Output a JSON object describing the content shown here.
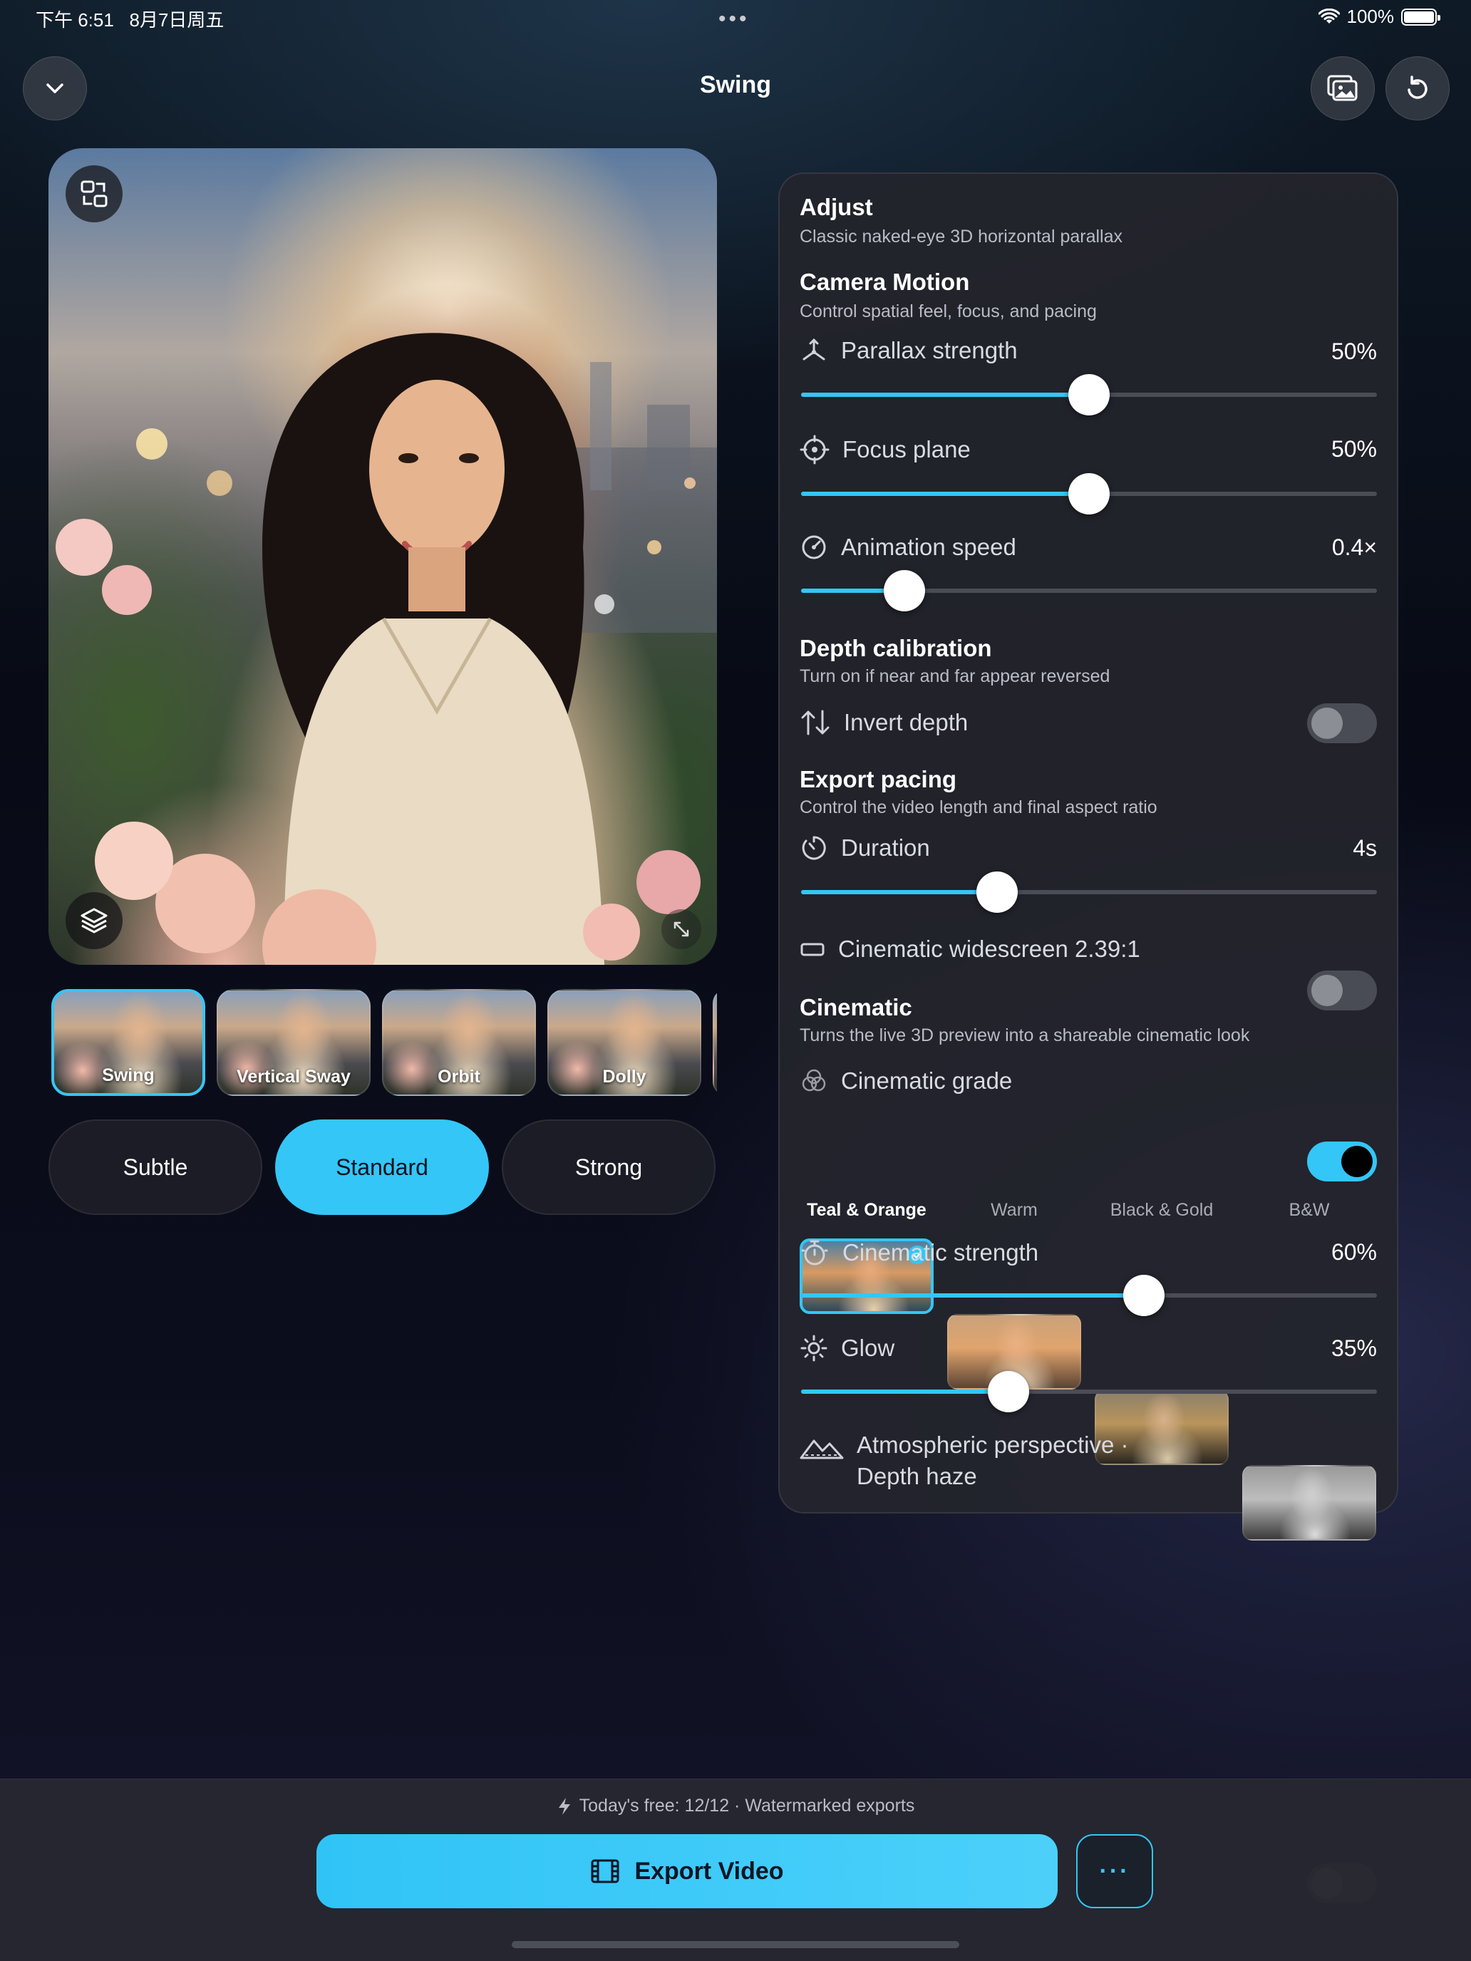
{
  "status": {
    "time": "下午 6:51   8月7日周五",
    "battery": "100%"
  },
  "header": {
    "title": "Swing"
  },
  "motions": [
    {
      "label": "Swing",
      "selected": true
    },
    {
      "label": "Vertical Sway",
      "selected": false
    },
    {
      "label": "Orbit",
      "selected": false
    },
    {
      "label": "Dolly",
      "selected": false
    }
  ],
  "intensity": {
    "options": [
      "Subtle",
      "Standard",
      "Strong"
    ],
    "selected": "Standard"
  },
  "panel": {
    "adjust": {
      "title": "Adjust",
      "subtitle": "Classic naked-eye 3D horizontal parallax"
    },
    "camera_motion": {
      "title": "Camera Motion",
      "subtitle": "Control spatial feel, focus, and pacing"
    },
    "parallax": {
      "label": "Parallax strength",
      "value": "50%",
      "level": 0.5
    },
    "focus": {
      "label": "Focus plane",
      "value": "50%",
      "level": 0.5
    },
    "speed": {
      "label": "Animation speed",
      "value": "0.4×",
      "level": 0.18
    },
    "depth": {
      "title": "Depth calibration",
      "subtitle": "Turn on if near and far appear reversed"
    },
    "invert": {
      "label": "Invert depth",
      "on": false
    },
    "export_pacing": {
      "title": "Export pacing",
      "subtitle": "Control the video length and final aspect ratio"
    },
    "duration": {
      "label": "Duration",
      "value": "4s",
      "level": 0.34
    },
    "widescreen": {
      "label": "Cinematic widescreen 2.39:1",
      "on": false
    },
    "cinematic": {
      "title": "Cinematic",
      "subtitle": "Turns the live 3D preview into a shareable cinematic look"
    },
    "grade_toggle": {
      "label": "Cinematic grade",
      "on": true
    },
    "grades": [
      {
        "label": "Teal & Orange",
        "selected": true
      },
      {
        "label": "Warm",
        "selected": false
      },
      {
        "label": "Black & Gold",
        "selected": false
      },
      {
        "label": "B&W",
        "selected": false
      }
    ],
    "cine_strength": {
      "label": "Cinematic strength",
      "value": "60%",
      "level": 0.595
    },
    "glow": {
      "label": "Glow",
      "value": "35%",
      "level": 0.36
    },
    "haze": {
      "label_line1": "Atmospheric perspective ·",
      "label_line2": "Depth haze",
      "on": false
    }
  },
  "footer": {
    "free_note": "Today's free: 12/12 · Watermarked exports",
    "export_label": "Export Video",
    "more_label": "···"
  },
  "colors": {
    "accent": "#34c6f6",
    "panel": "#24252c",
    "background": "#0a0c18"
  }
}
